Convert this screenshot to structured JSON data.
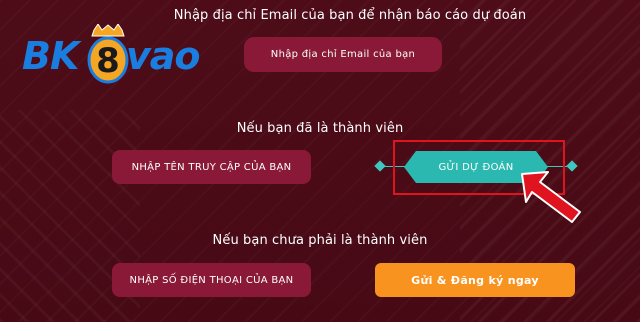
{
  "logo": {
    "prefix": "BK",
    "digit": "8",
    "suffix": "vao",
    "colors": {
      "text": "#1a7de0",
      "digit_fill": "#f5a623"
    }
  },
  "sections": {
    "email": {
      "heading": "Nhập địa chỉ Email của bạn để nhận báo cáo dự đoán",
      "input_label": "Nhập địa chỉ Email của bạn"
    },
    "member": {
      "heading": "Nếu bạn đã là thành viên",
      "username_label": "NHẬP TÊN TRUY CẬP CỦA BẠN",
      "submit_label": "GỬI DỰ ĐOÁN"
    },
    "non_member": {
      "heading": "Nếu bạn chưa phải là thành viên",
      "phone_label": "NHẬP SỐ ĐIỆN THOẠI CỦA BẠN",
      "register_label": "Gửi & Đăng ký ngay"
    }
  },
  "colors": {
    "background": "#4a0b17",
    "field": "#8a1938",
    "submit": "#2ab8b0",
    "register": "#f7931e",
    "highlight": "#e0141e"
  },
  "icons": [
    "diamond-ornament-icon",
    "arrow-pointer-icon"
  ]
}
